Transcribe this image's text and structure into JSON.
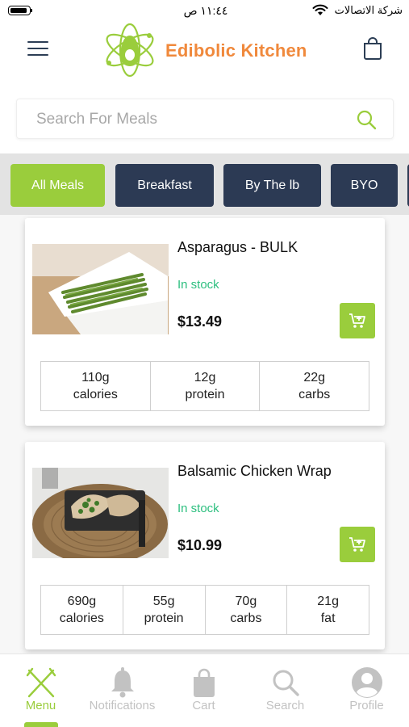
{
  "status_bar": {
    "time": "١١:٤٤ ص",
    "carrier": "شركة الاتصالات"
  },
  "header": {
    "brand": "Edibolic Kitchen"
  },
  "search": {
    "placeholder": "Search For Meals"
  },
  "categories": [
    {
      "label": "All Meals",
      "active": true
    },
    {
      "label": "Breakfast",
      "active": false
    },
    {
      "label": "By The lb",
      "active": false
    },
    {
      "label": "BYO",
      "active": false
    }
  ],
  "meals": [
    {
      "name": "Asparagus - BULK",
      "stock": "In stock",
      "price": "$13.49",
      "nutrition": [
        {
          "value": "110g",
          "label": "calories"
        },
        {
          "value": "12g",
          "label": "protein"
        },
        {
          "value": "22g",
          "label": "carbs"
        }
      ]
    },
    {
      "name": "Balsamic Chicken Wrap",
      "stock": "In stock",
      "price": "$10.99",
      "nutrition": [
        {
          "value": "690g",
          "label": "calories"
        },
        {
          "value": "55g",
          "label": "protein"
        },
        {
          "value": "70g",
          "label": "carbs"
        },
        {
          "value": "21g",
          "label": "fat"
        }
      ]
    }
  ],
  "bottom_nav": [
    {
      "label": "Menu",
      "icon": "fork-knife-icon",
      "active": true
    },
    {
      "label": "Notifications",
      "icon": "bell-icon",
      "active": false
    },
    {
      "label": "Cart",
      "icon": "shopping-bag-icon",
      "active": false
    },
    {
      "label": "Search",
      "icon": "search-icon",
      "active": false
    },
    {
      "label": "Profile",
      "icon": "profile-icon",
      "active": false
    }
  ],
  "colors": {
    "accent": "#9acd3c",
    "navy": "#2c3a54",
    "brand_orange": "#f0893c",
    "in_stock": "#2dbf7f"
  }
}
